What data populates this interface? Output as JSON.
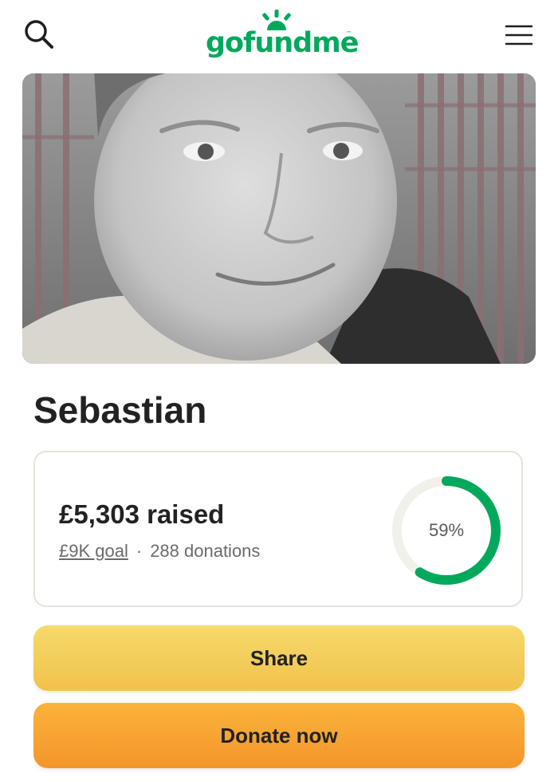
{
  "header": {
    "logo_text": "gofundme",
    "logo_tm": "™",
    "search_icon": "search-icon",
    "menu_icon": "hamburger-menu-icon"
  },
  "campaign": {
    "title": "Sebastian",
    "raised_text": "£5,303 raised",
    "goal_text": "£9K goal",
    "separator": "·",
    "donations_text": "288 donations",
    "progress_percent": 59,
    "progress_label": "59%"
  },
  "actions": {
    "share_label": "Share",
    "donate_label": "Donate now"
  },
  "colors": {
    "brand_green": "#02a95c",
    "progress_track": "#f1f0ea",
    "share_yellow": "#f3c94f",
    "donate_orange": "#f7a532"
  }
}
